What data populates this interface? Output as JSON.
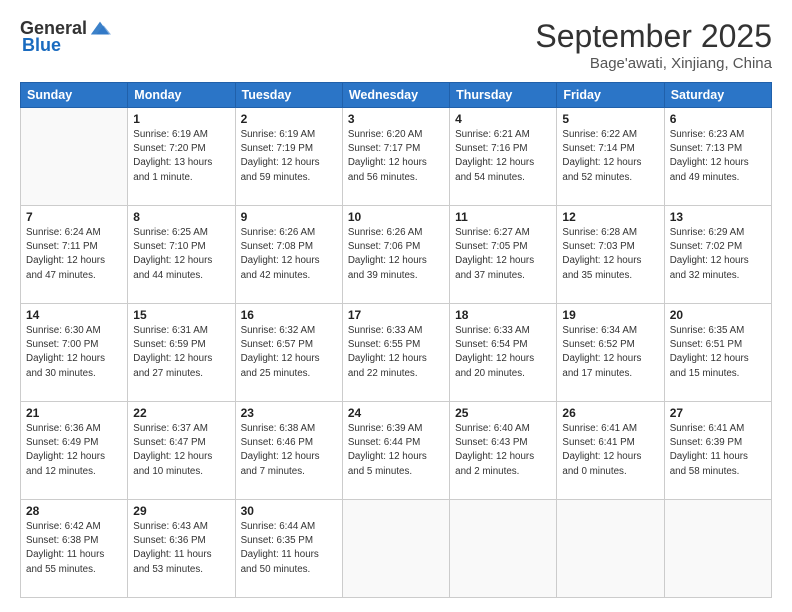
{
  "header": {
    "logo_general": "General",
    "logo_blue": "Blue",
    "title": "September 2025",
    "location": "Bage'awati, Xinjiang, China"
  },
  "weekdays": [
    "Sunday",
    "Monday",
    "Tuesday",
    "Wednesday",
    "Thursday",
    "Friday",
    "Saturday"
  ],
  "weeks": [
    [
      {
        "day": "",
        "sunrise": "",
        "sunset": "",
        "daylight": ""
      },
      {
        "day": "1",
        "sunrise": "Sunrise: 6:19 AM",
        "sunset": "Sunset: 7:20 PM",
        "daylight": "Daylight: 13 hours and 1 minute."
      },
      {
        "day": "2",
        "sunrise": "Sunrise: 6:19 AM",
        "sunset": "Sunset: 7:19 PM",
        "daylight": "Daylight: 12 hours and 59 minutes."
      },
      {
        "day": "3",
        "sunrise": "Sunrise: 6:20 AM",
        "sunset": "Sunset: 7:17 PM",
        "daylight": "Daylight: 12 hours and 56 minutes."
      },
      {
        "day": "4",
        "sunrise": "Sunrise: 6:21 AM",
        "sunset": "Sunset: 7:16 PM",
        "daylight": "Daylight: 12 hours and 54 minutes."
      },
      {
        "day": "5",
        "sunrise": "Sunrise: 6:22 AM",
        "sunset": "Sunset: 7:14 PM",
        "daylight": "Daylight: 12 hours and 52 minutes."
      },
      {
        "day": "6",
        "sunrise": "Sunrise: 6:23 AM",
        "sunset": "Sunset: 7:13 PM",
        "daylight": "Daylight: 12 hours and 49 minutes."
      }
    ],
    [
      {
        "day": "7",
        "sunrise": "Sunrise: 6:24 AM",
        "sunset": "Sunset: 7:11 PM",
        "daylight": "Daylight: 12 hours and 47 minutes."
      },
      {
        "day": "8",
        "sunrise": "Sunrise: 6:25 AM",
        "sunset": "Sunset: 7:10 PM",
        "daylight": "Daylight: 12 hours and 44 minutes."
      },
      {
        "day": "9",
        "sunrise": "Sunrise: 6:26 AM",
        "sunset": "Sunset: 7:08 PM",
        "daylight": "Daylight: 12 hours and 42 minutes."
      },
      {
        "day": "10",
        "sunrise": "Sunrise: 6:26 AM",
        "sunset": "Sunset: 7:06 PM",
        "daylight": "Daylight: 12 hours and 39 minutes."
      },
      {
        "day": "11",
        "sunrise": "Sunrise: 6:27 AM",
        "sunset": "Sunset: 7:05 PM",
        "daylight": "Daylight: 12 hours and 37 minutes."
      },
      {
        "day": "12",
        "sunrise": "Sunrise: 6:28 AM",
        "sunset": "Sunset: 7:03 PM",
        "daylight": "Daylight: 12 hours and 35 minutes."
      },
      {
        "day": "13",
        "sunrise": "Sunrise: 6:29 AM",
        "sunset": "Sunset: 7:02 PM",
        "daylight": "Daylight: 12 hours and 32 minutes."
      }
    ],
    [
      {
        "day": "14",
        "sunrise": "Sunrise: 6:30 AM",
        "sunset": "Sunset: 7:00 PM",
        "daylight": "Daylight: 12 hours and 30 minutes."
      },
      {
        "day": "15",
        "sunrise": "Sunrise: 6:31 AM",
        "sunset": "Sunset: 6:59 PM",
        "daylight": "Daylight: 12 hours and 27 minutes."
      },
      {
        "day": "16",
        "sunrise": "Sunrise: 6:32 AM",
        "sunset": "Sunset: 6:57 PM",
        "daylight": "Daylight: 12 hours and 25 minutes."
      },
      {
        "day": "17",
        "sunrise": "Sunrise: 6:33 AM",
        "sunset": "Sunset: 6:55 PM",
        "daylight": "Daylight: 12 hours and 22 minutes."
      },
      {
        "day": "18",
        "sunrise": "Sunrise: 6:33 AM",
        "sunset": "Sunset: 6:54 PM",
        "daylight": "Daylight: 12 hours and 20 minutes."
      },
      {
        "day": "19",
        "sunrise": "Sunrise: 6:34 AM",
        "sunset": "Sunset: 6:52 PM",
        "daylight": "Daylight: 12 hours and 17 minutes."
      },
      {
        "day": "20",
        "sunrise": "Sunrise: 6:35 AM",
        "sunset": "Sunset: 6:51 PM",
        "daylight": "Daylight: 12 hours and 15 minutes."
      }
    ],
    [
      {
        "day": "21",
        "sunrise": "Sunrise: 6:36 AM",
        "sunset": "Sunset: 6:49 PM",
        "daylight": "Daylight: 12 hours and 12 minutes."
      },
      {
        "day": "22",
        "sunrise": "Sunrise: 6:37 AM",
        "sunset": "Sunset: 6:47 PM",
        "daylight": "Daylight: 12 hours and 10 minutes."
      },
      {
        "day": "23",
        "sunrise": "Sunrise: 6:38 AM",
        "sunset": "Sunset: 6:46 PM",
        "daylight": "Daylight: 12 hours and 7 minutes."
      },
      {
        "day": "24",
        "sunrise": "Sunrise: 6:39 AM",
        "sunset": "Sunset: 6:44 PM",
        "daylight": "Daylight: 12 hours and 5 minutes."
      },
      {
        "day": "25",
        "sunrise": "Sunrise: 6:40 AM",
        "sunset": "Sunset: 6:43 PM",
        "daylight": "Daylight: 12 hours and 2 minutes."
      },
      {
        "day": "26",
        "sunrise": "Sunrise: 6:41 AM",
        "sunset": "Sunset: 6:41 PM",
        "daylight": "Daylight: 12 hours and 0 minutes."
      },
      {
        "day": "27",
        "sunrise": "Sunrise: 6:41 AM",
        "sunset": "Sunset: 6:39 PM",
        "daylight": "Daylight: 11 hours and 58 minutes."
      }
    ],
    [
      {
        "day": "28",
        "sunrise": "Sunrise: 6:42 AM",
        "sunset": "Sunset: 6:38 PM",
        "daylight": "Daylight: 11 hours and 55 minutes."
      },
      {
        "day": "29",
        "sunrise": "Sunrise: 6:43 AM",
        "sunset": "Sunset: 6:36 PM",
        "daylight": "Daylight: 11 hours and 53 minutes."
      },
      {
        "day": "30",
        "sunrise": "Sunrise: 6:44 AM",
        "sunset": "Sunset: 6:35 PM",
        "daylight": "Daylight: 11 hours and 50 minutes."
      },
      {
        "day": "",
        "sunrise": "",
        "sunset": "",
        "daylight": ""
      },
      {
        "day": "",
        "sunrise": "",
        "sunset": "",
        "daylight": ""
      },
      {
        "day": "",
        "sunrise": "",
        "sunset": "",
        "daylight": ""
      },
      {
        "day": "",
        "sunrise": "",
        "sunset": "",
        "daylight": ""
      }
    ]
  ]
}
